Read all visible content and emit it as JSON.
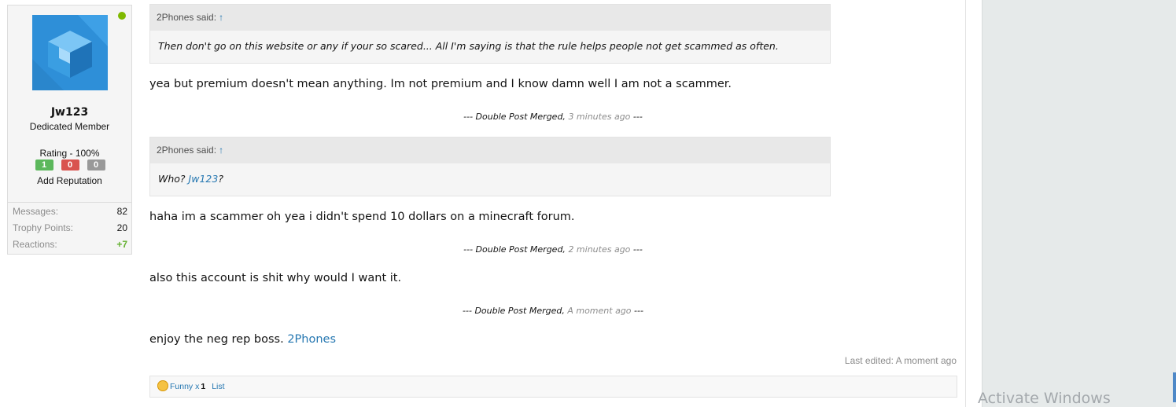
{
  "user": {
    "username": "Jw123",
    "title": "Dedicated Member",
    "rating_label": "Rating - 100%",
    "rep_positive": "1",
    "rep_negative": "0",
    "rep_neutral": "0",
    "add_reputation": "Add Reputation",
    "stats": [
      {
        "label": "Messages:",
        "value": "82"
      },
      {
        "label": "Trophy Points:",
        "value": "20"
      },
      {
        "label": "Reactions:",
        "value": "+7"
      }
    ],
    "online_color": "#7fb900",
    "avatar_icon": "cube-logo-icon"
  },
  "quotes": [
    {
      "author": "2Phones said:",
      "arrow": "↑",
      "text": "Then don't go on this website or any if your so scared... All I'm saying is that the rule helps people not get scammed as often."
    },
    {
      "author": "2Phones said:",
      "arrow": "↑",
      "text_prefix": "Who? ",
      "mention": "Jw123",
      "text_suffix": "?"
    }
  ],
  "posts": [
    "yea but premium doesn't mean anything. Im not premium and I know damn well I am not a scammer.",
    "haha im a scammer oh yea i didn't spend 10 dollars on a minecraft forum.",
    "also this account is shit why would I want it.",
    "enjoy the neg rep boss. "
  ],
  "final_mention": "2Phones",
  "merges": [
    {
      "prefix": "--- Double Post Merged,",
      "time": "3 minutes ago",
      "suffix": "---"
    },
    {
      "prefix": "--- Double Post Merged,",
      "time": "2 minutes ago",
      "suffix": "---"
    },
    {
      "prefix": "--- Double Post Merged,",
      "time": "A moment ago",
      "suffix": "---"
    }
  ],
  "last_edited": "Last edited: A moment ago",
  "reactions": {
    "label": "Funny x",
    "count": "1",
    "list_link": "List",
    "icon": "laughing-emoji-icon"
  },
  "overlay": {
    "activate_windows": "Activate Windows"
  },
  "colors": {
    "link": "#2577b1",
    "rep_positive": "#5cb85c",
    "rep_negative": "#d9534f",
    "rep_neutral": "#999999",
    "sidebar_bg": "#e6eaea"
  }
}
